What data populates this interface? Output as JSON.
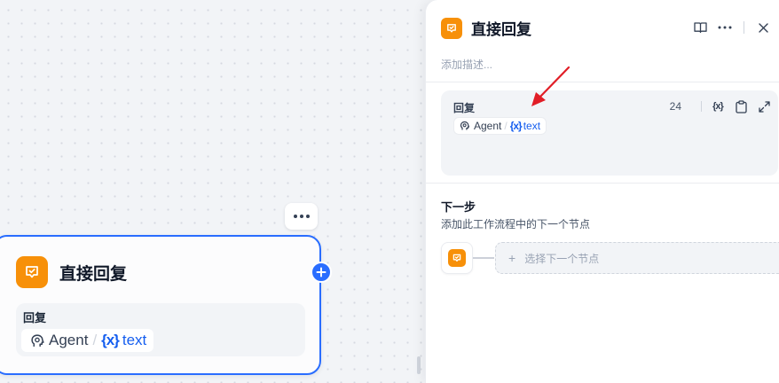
{
  "canvas": {
    "node": {
      "title": "直接回复",
      "field_label": "回复",
      "var_source": "Agent",
      "var_separator": "/",
      "var_brace": "{x}",
      "var_name": "text"
    }
  },
  "panel": {
    "title": "直接回复",
    "description_placeholder": "添加描述...",
    "reply": {
      "label": "回复",
      "char_count": "24",
      "var_brace_button": "{x}",
      "var_source": "Agent",
      "var_separator": "/",
      "var_brace": "{x}",
      "var_name": "text"
    },
    "next_step": {
      "title": "下一步",
      "description": "添加此工作流程中的下一个节点",
      "select_plus": "+",
      "select_label": "选择下一个节点"
    }
  },
  "colors": {
    "accent": "#296dff",
    "node_icon": "#f79009",
    "annotation_arrow": "#e11d26"
  },
  "icons": {
    "node": "reply-node-icon",
    "agent": "agent-brain-icon"
  }
}
